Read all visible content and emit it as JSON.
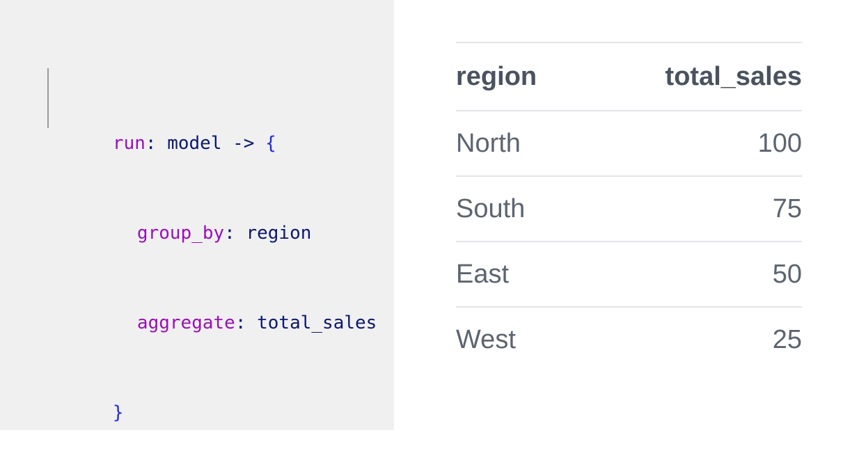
{
  "query": {
    "lines": [
      {
        "tokens": [
          {
            "text": "run",
            "kind": "kw"
          },
          {
            "text": ": ",
            "kind": "punct"
          },
          {
            "text": "model",
            "kind": "ident"
          },
          {
            "text": " -> ",
            "kind": "punct"
          },
          {
            "text": "{",
            "kind": "brace"
          }
        ]
      },
      {
        "indented": true,
        "tokens": [
          {
            "text": "group_by",
            "kind": "kw"
          },
          {
            "text": ": ",
            "kind": "punct"
          },
          {
            "text": "region",
            "kind": "ident"
          }
        ]
      },
      {
        "indented": true,
        "tokens": [
          {
            "text": "aggregate",
            "kind": "kw"
          },
          {
            "text": ": ",
            "kind": "punct"
          },
          {
            "text": "total_sales",
            "kind": "ident"
          }
        ]
      },
      {
        "tokens": [
          {
            "text": "}",
            "kind": "brace"
          }
        ]
      }
    ],
    "colors": {
      "keyword": "#9a0fb8",
      "identifier": "#0b1770",
      "brace": "#2128e6",
      "background": "#f0f0f0"
    }
  },
  "results": {
    "columns": [
      "region",
      "total_sales"
    ],
    "rows": [
      [
        "North",
        "100"
      ],
      [
        "South",
        "75"
      ],
      [
        "East",
        "50"
      ],
      [
        "West",
        "25"
      ]
    ]
  }
}
